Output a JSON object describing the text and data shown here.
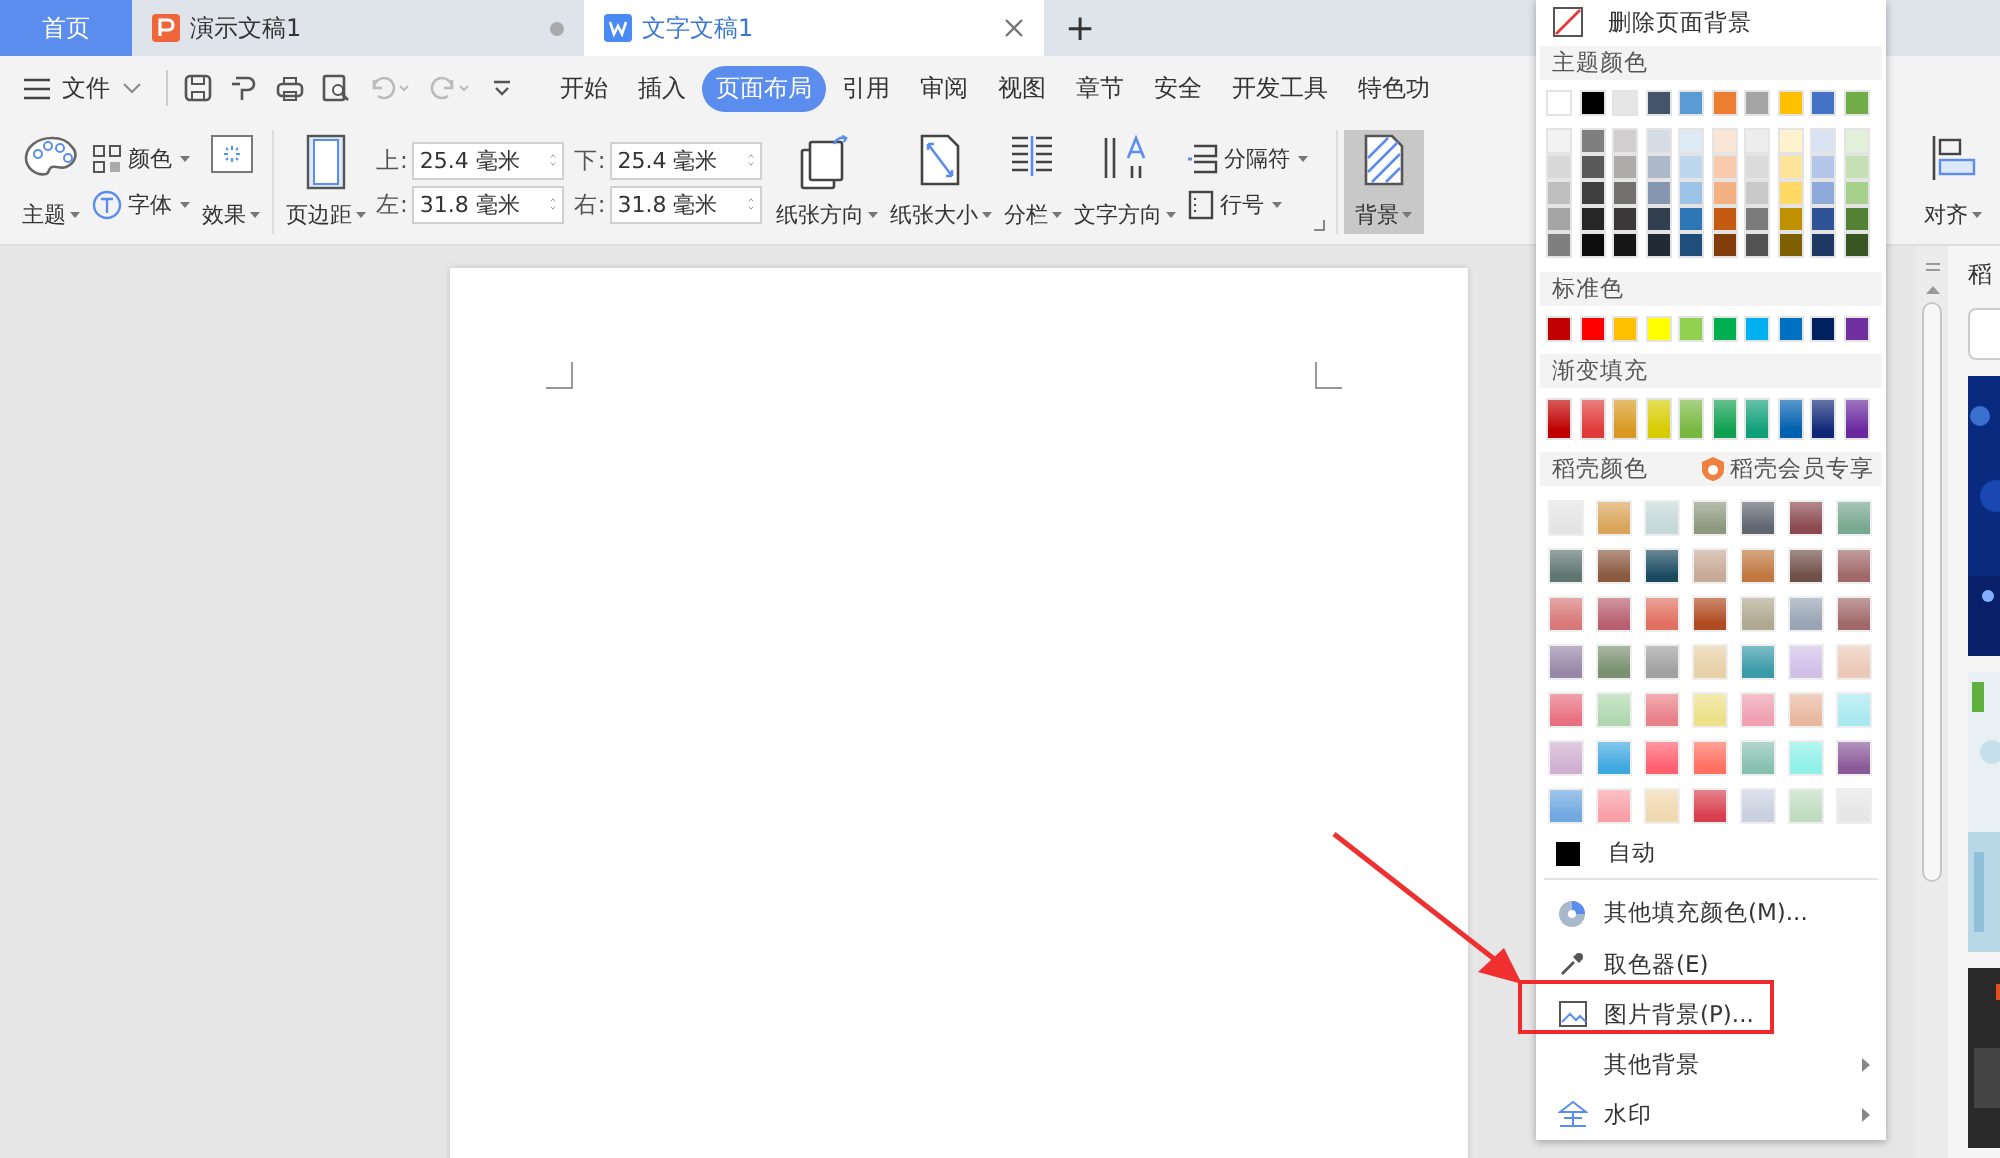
{
  "tabs": [
    {
      "label": "首页",
      "kind": "home",
      "selected": false
    },
    {
      "label": "演示文稿1",
      "kind": "presentation",
      "selected": false
    },
    {
      "label": "文字文稿1",
      "kind": "writer",
      "selected": true
    }
  ],
  "new_tab": "+",
  "menu": {
    "file": "文件",
    "ribbon_tabs": [
      {
        "label": "开始",
        "selected": false
      },
      {
        "label": "插入",
        "selected": false
      },
      {
        "label": "页面布局",
        "selected": true
      },
      {
        "label": "引用",
        "selected": false
      },
      {
        "label": "审阅",
        "selected": false
      },
      {
        "label": "视图",
        "selected": false
      },
      {
        "label": "章节",
        "selected": false
      },
      {
        "label": "安全",
        "selected": false
      },
      {
        "label": "开发工具",
        "selected": false
      },
      {
        "label": "特色功",
        "selected": false
      }
    ]
  },
  "ribbon": {
    "theme": "主题",
    "colors": "颜色",
    "fonts": "字体",
    "effects": "效果",
    "margins_button": "页边距",
    "margins": [
      {
        "label": "上:",
        "value": "25.4 毫米"
      },
      {
        "label": "下:",
        "value": "25.4 毫米"
      },
      {
        "label": "左:",
        "value": "31.8 毫米"
      },
      {
        "label": "右:",
        "value": "31.8 毫米"
      }
    ],
    "layout_buttons": [
      {
        "kind": "orientation",
        "label": "纸张方向"
      },
      {
        "kind": "size",
        "label": "纸张大小"
      },
      {
        "kind": "columns",
        "label": "分栏"
      },
      {
        "kind": "direction",
        "label": "文字方向"
      }
    ],
    "small_buttons": [
      {
        "kind": "breaks",
        "label": "分隔符"
      },
      {
        "kind": "line_numbers",
        "label": "行号"
      }
    ],
    "background": {
      "label": "背景",
      "pressed": true
    },
    "align": "对齐"
  },
  "side_panel": {
    "title": "稻"
  },
  "background_menu": {
    "remove": "删除页面背景",
    "theme_title": "主题颜色",
    "theme_colors": [
      {
        "color": "#ffffff"
      },
      {
        "color": "#000000"
      },
      {
        "color": "#e7e6e6"
      },
      {
        "color": "#44546a"
      },
      {
        "color": "#5b9bd5"
      },
      {
        "color": "#ed7d31"
      },
      {
        "color": "#a5a5a5"
      },
      {
        "color": "#ffc000"
      },
      {
        "color": "#4472c4"
      },
      {
        "color": "#70ad47"
      }
    ],
    "theme_shades": [
      [
        {
          "color": "#f2f2f2"
        },
        {
          "color": "#7f7f7f"
        },
        {
          "color": "#d0cece"
        },
        {
          "color": "#d6dce4"
        },
        {
          "color": "#deebf6"
        },
        {
          "color": "#fbe5d5"
        },
        {
          "color": "#ededed"
        },
        {
          "color": "#fff2cc"
        },
        {
          "color": "#d9e2f3"
        },
        {
          "color": "#e2efd9"
        }
      ],
      [
        {
          "color": "#d8d8d8"
        },
        {
          "color": "#595959"
        },
        {
          "color": "#aeabab"
        },
        {
          "color": "#adb9ca"
        },
        {
          "color": "#bdd7ee"
        },
        {
          "color": "#f7cbac"
        },
        {
          "color": "#dbdbdb"
        },
        {
          "color": "#fee599"
        },
        {
          "color": "#b4c6e7"
        },
        {
          "color": "#c5e0b3"
        }
      ],
      [
        {
          "color": "#bfbfbf"
        },
        {
          "color": "#3f3f3f"
        },
        {
          "color": "#757070"
        },
        {
          "color": "#8496b0"
        },
        {
          "color": "#9dc3e6"
        },
        {
          "color": "#f4b183"
        },
        {
          "color": "#c9c9c9"
        },
        {
          "color": "#ffd965"
        },
        {
          "color": "#8eaadb"
        },
        {
          "color": "#a8d08d"
        }
      ],
      [
        {
          "color": "#a5a5a5"
        },
        {
          "color": "#262626"
        },
        {
          "color": "#3a3838"
        },
        {
          "color": "#323f4f"
        },
        {
          "color": "#2e75b5"
        },
        {
          "color": "#c55a11"
        },
        {
          "color": "#7b7b7b"
        },
        {
          "color": "#bf9000"
        },
        {
          "color": "#2f5496"
        },
        {
          "color": "#538135"
        }
      ],
      [
        {
          "color": "#7f7f7f"
        },
        {
          "color": "#0c0c0c"
        },
        {
          "color": "#171616"
        },
        {
          "color": "#222a35"
        },
        {
          "color": "#1e4e79"
        },
        {
          "color": "#833c0b"
        },
        {
          "color": "#525252"
        },
        {
          "color": "#7f6000"
        },
        {
          "color": "#1f3864"
        },
        {
          "color": "#375623"
        }
      ]
    ],
    "standard_title": "标准色",
    "standard_colors": [
      {
        "color": "#c00000"
      },
      {
        "color": "#ff0000"
      },
      {
        "color": "#ffc000"
      },
      {
        "color": "#ffff00"
      },
      {
        "color": "#92d050"
      },
      {
        "color": "#00b050"
      },
      {
        "color": "#00b0f0"
      },
      {
        "color": "#0070c0"
      },
      {
        "color": "#002060"
      },
      {
        "color": "#7030a0"
      }
    ],
    "gradient_title": "渐变填充",
    "gradient_colors": [
      {
        "color": "#c00000"
      },
      {
        "color": "#e03a3a"
      },
      {
        "color": "#d89a20"
      },
      {
        "color": "#d8cc00"
      },
      {
        "color": "#78b840"
      },
      {
        "color": "#10a050"
      },
      {
        "color": "#10a078"
      },
      {
        "color": "#0060b0"
      },
      {
        "color": "#102878"
      },
      {
        "color": "#6a28a0"
      }
    ],
    "daoke_title": "稻壳颜色",
    "daoke_member": "稻壳会员专享",
    "daoke_colors": [
      [
        {
          "color": "#e4e4e4"
        },
        {
          "color": "#d9a55a"
        },
        {
          "color": "#c5d8d8"
        },
        {
          "color": "#8d9a80"
        },
        {
          "color": "#5f6670"
        },
        {
          "color": "#8a4a50"
        },
        {
          "color": "#78a890"
        }
      ],
      [
        {
          "color": "#5f7570"
        },
        {
          "color": "#8a5a40"
        },
        {
          "color": "#1a4a60"
        },
        {
          "color": "#c8aa98"
        },
        {
          "color": "#c07840"
        },
        {
          "color": "#705048"
        },
        {
          "color": "#a06868"
        }
      ],
      [
        {
          "color": "#d87878"
        },
        {
          "color": "#b86070"
        },
        {
          "color": "#e07060"
        },
        {
          "color": "#b04a20"
        },
        {
          "color": "#b0a890"
        },
        {
          "color": "#98a4b4"
        },
        {
          "color": "#a06868"
        }
      ],
      [
        {
          "color": "#9888a8"
        },
        {
          "color": "#7a9070"
        },
        {
          "color": "#a0a0a0"
        },
        {
          "color": "#e8d0a8"
        },
        {
          "color": "#3a9aa8"
        },
        {
          "color": "#d0c0e8"
        },
        {
          "color": "#ecc8b8"
        }
      ],
      [
        {
          "color": "#e87080"
        },
        {
          "color": "#b0d8b0"
        },
        {
          "color": "#e88088"
        },
        {
          "color": "#ece088"
        },
        {
          "color": "#f0a0b0"
        },
        {
          "color": "#e8b8a0"
        },
        {
          "color": "#a8e8f0"
        }
      ],
      [
        {
          "color": "#d0b0d0"
        },
        {
          "color": "#40a8e0"
        },
        {
          "color": "#ff6070"
        },
        {
          "color": "#ff7060"
        },
        {
          "color": "#88c0b0"
        },
        {
          "color": "#90f0e8"
        },
        {
          "color": "#8a5a98"
        }
      ],
      [
        {
          "color": "#70a8e0"
        },
        {
          "color": "#f8a0a8"
        },
        {
          "color": "#f0d8b0"
        },
        {
          "color": "#d84050"
        },
        {
          "color": "#c8d0e0"
        },
        {
          "color": "#c0dcc0"
        },
        {
          "color": "#e6e6e6"
        }
      ]
    ],
    "auto": "自动",
    "items": [
      {
        "kind": "more_colors",
        "label": "其他填充颜色(M)...",
        "submenu": false
      },
      {
        "kind": "picker",
        "label": "取色器(E)",
        "submenu": false
      },
      {
        "kind": "picture",
        "label": "图片背景(P)...",
        "submenu": false
      },
      {
        "kind": "other",
        "label": "其他背景",
        "submenu": true
      },
      {
        "kind": "watermark",
        "label": "水印",
        "submenu": true
      }
    ]
  }
}
